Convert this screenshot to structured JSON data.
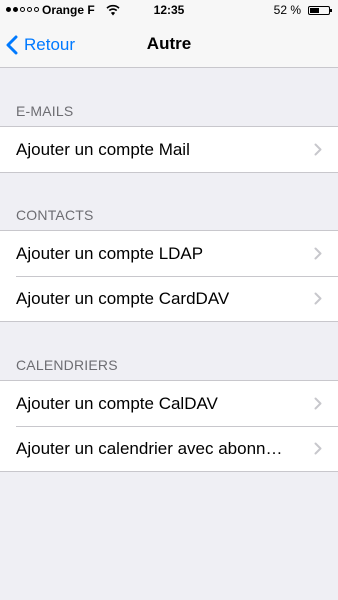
{
  "status_bar": {
    "carrier": "Orange F",
    "time": "12:35",
    "battery": "52 %",
    "battery_level": 0.52,
    "signal_strength": 2,
    "signal_max": 5
  },
  "nav": {
    "back_label": "Retour",
    "title": "Autre"
  },
  "colors": {
    "accent": "#007aff",
    "background": "#efeff4",
    "section_text": "#6d6d72",
    "separator": "#c8c7cc",
    "chevron": "#c7c7cc"
  },
  "sections": [
    {
      "header": "E-MAILS",
      "items": [
        {
          "label": "Ajouter un compte Mail"
        }
      ]
    },
    {
      "header": "CONTACTS",
      "items": [
        {
          "label": "Ajouter un compte LDAP"
        },
        {
          "label": "Ajouter un compte CardDAV"
        }
      ]
    },
    {
      "header": "CALENDRIERS",
      "items": [
        {
          "label": "Ajouter un compte CalDAV"
        },
        {
          "label": "Ajouter un calendrier avec abonn…"
        }
      ]
    }
  ]
}
